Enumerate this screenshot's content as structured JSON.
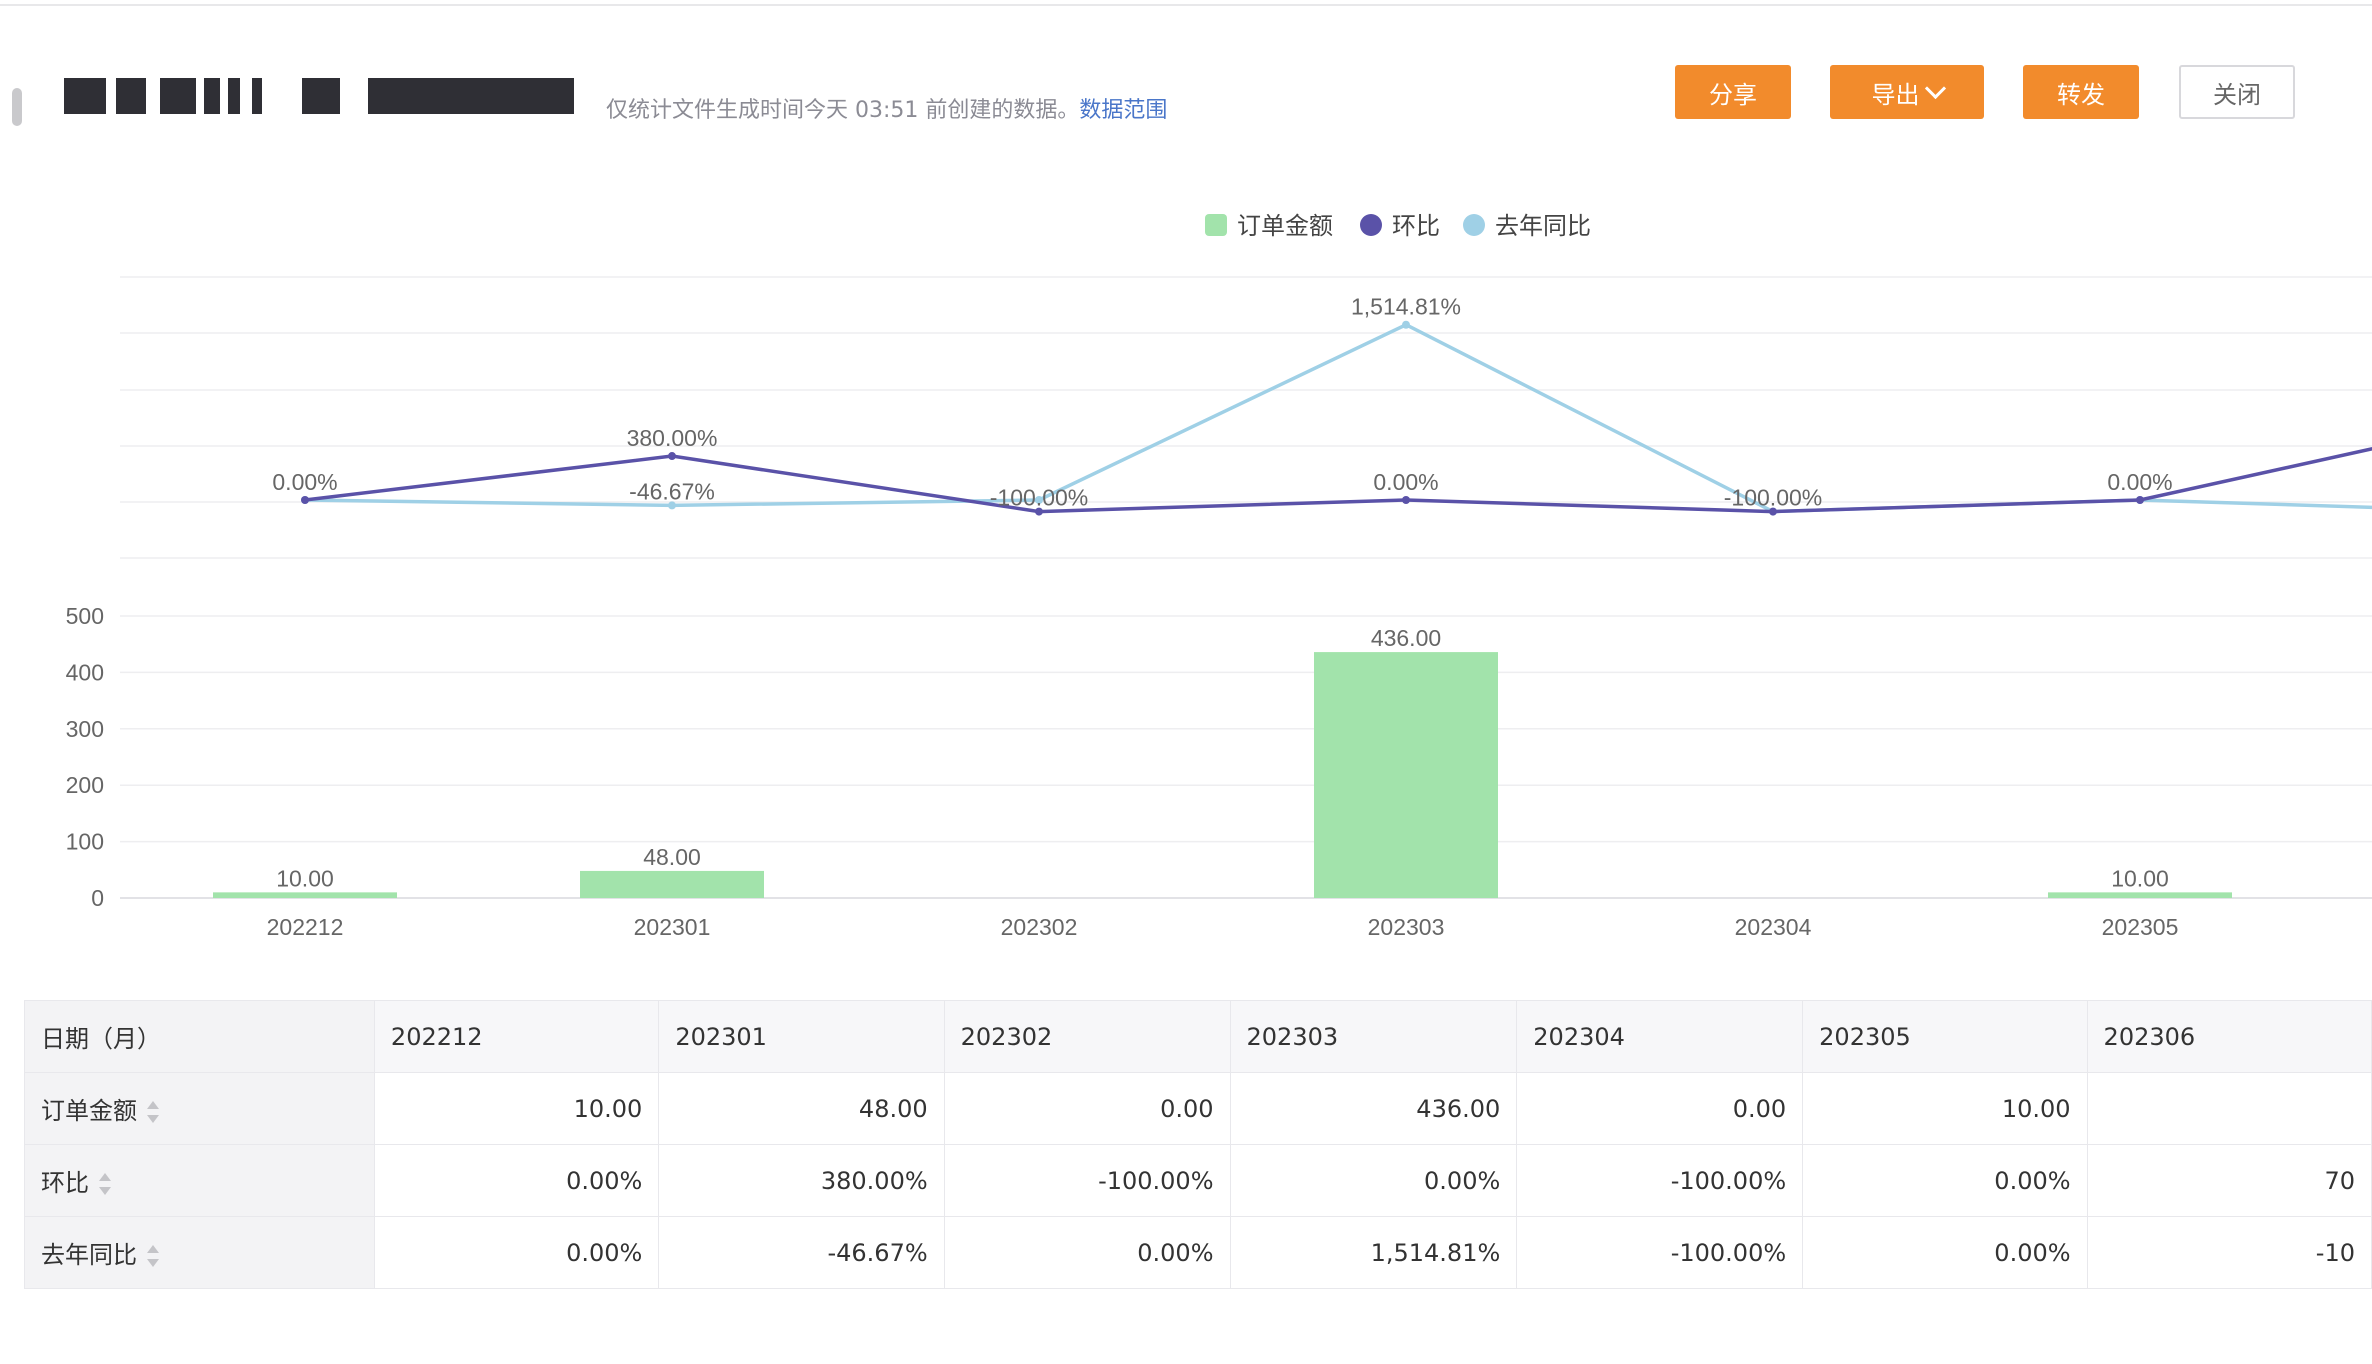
{
  "header": {
    "subtitle_text": "仅统计文件生成时间今天 03:51 前创建的数据。",
    "subtitle_link": "数据范围",
    "buttons": {
      "share": "分享",
      "export": "导出",
      "forward": "转发",
      "close": "关闭"
    }
  },
  "colors": {
    "bar": "#a2e3ab",
    "mom": "#5a52a8",
    "yoy": "#9fd0e6",
    "accent": "#f28b2c"
  },
  "chart_data": {
    "type": "bar+line",
    "categories": [
      "202212",
      "202301",
      "202302",
      "202303",
      "202304",
      "202305",
      "202306"
    ],
    "legend": [
      "订单金额",
      "环比",
      "去年同比"
    ],
    "legend_position": "top-center",
    "ylim": [
      0,
      500
    ],
    "yticks": [
      "0",
      "100",
      "200",
      "300",
      "400",
      "500"
    ],
    "grid": true,
    "series": [
      {
        "name": "订单金额",
        "type": "bar",
        "values": [
          10,
          48,
          0,
          436,
          0,
          10,
          null
        ],
        "labels": [
          "10.00",
          "48.00",
          "",
          "436.00",
          "",
          "10.00",
          ""
        ]
      },
      {
        "name": "环比",
        "type": "line",
        "values": [
          0,
          380,
          -100,
          0,
          -100,
          0,
          700
        ],
        "labels": [
          "0.00%",
          "380.00%",
          "-100.00%",
          "0.00%",
          "-100.00%",
          "0.00%",
          ""
        ]
      },
      {
        "name": "去年同比",
        "type": "line",
        "values": [
          0,
          -46.67,
          0,
          1514.81,
          -100,
          0,
          -100
        ],
        "labels": [
          "",
          "-46.67%",
          "",
          "1,514.81%",
          "",
          "",
          ""
        ]
      }
    ]
  },
  "table": {
    "row_headers": [
      "日期（月）",
      "订单金额",
      "环比",
      "去年同比"
    ],
    "columns": [
      "202212",
      "202301",
      "202302",
      "202303",
      "202304",
      "202305",
      "202306"
    ],
    "rows": [
      [
        "10.00",
        "48.00",
        "0.00",
        "436.00",
        "0.00",
        "10.00",
        ""
      ],
      [
        "0.00%",
        "380.00%",
        "-100.00%",
        "0.00%",
        "-100.00%",
        "0.00%",
        "70"
      ],
      [
        "0.00%",
        "-46.67%",
        "0.00%",
        "1,514.81%",
        "-100.00%",
        "0.00%",
        "-10"
      ]
    ]
  }
}
